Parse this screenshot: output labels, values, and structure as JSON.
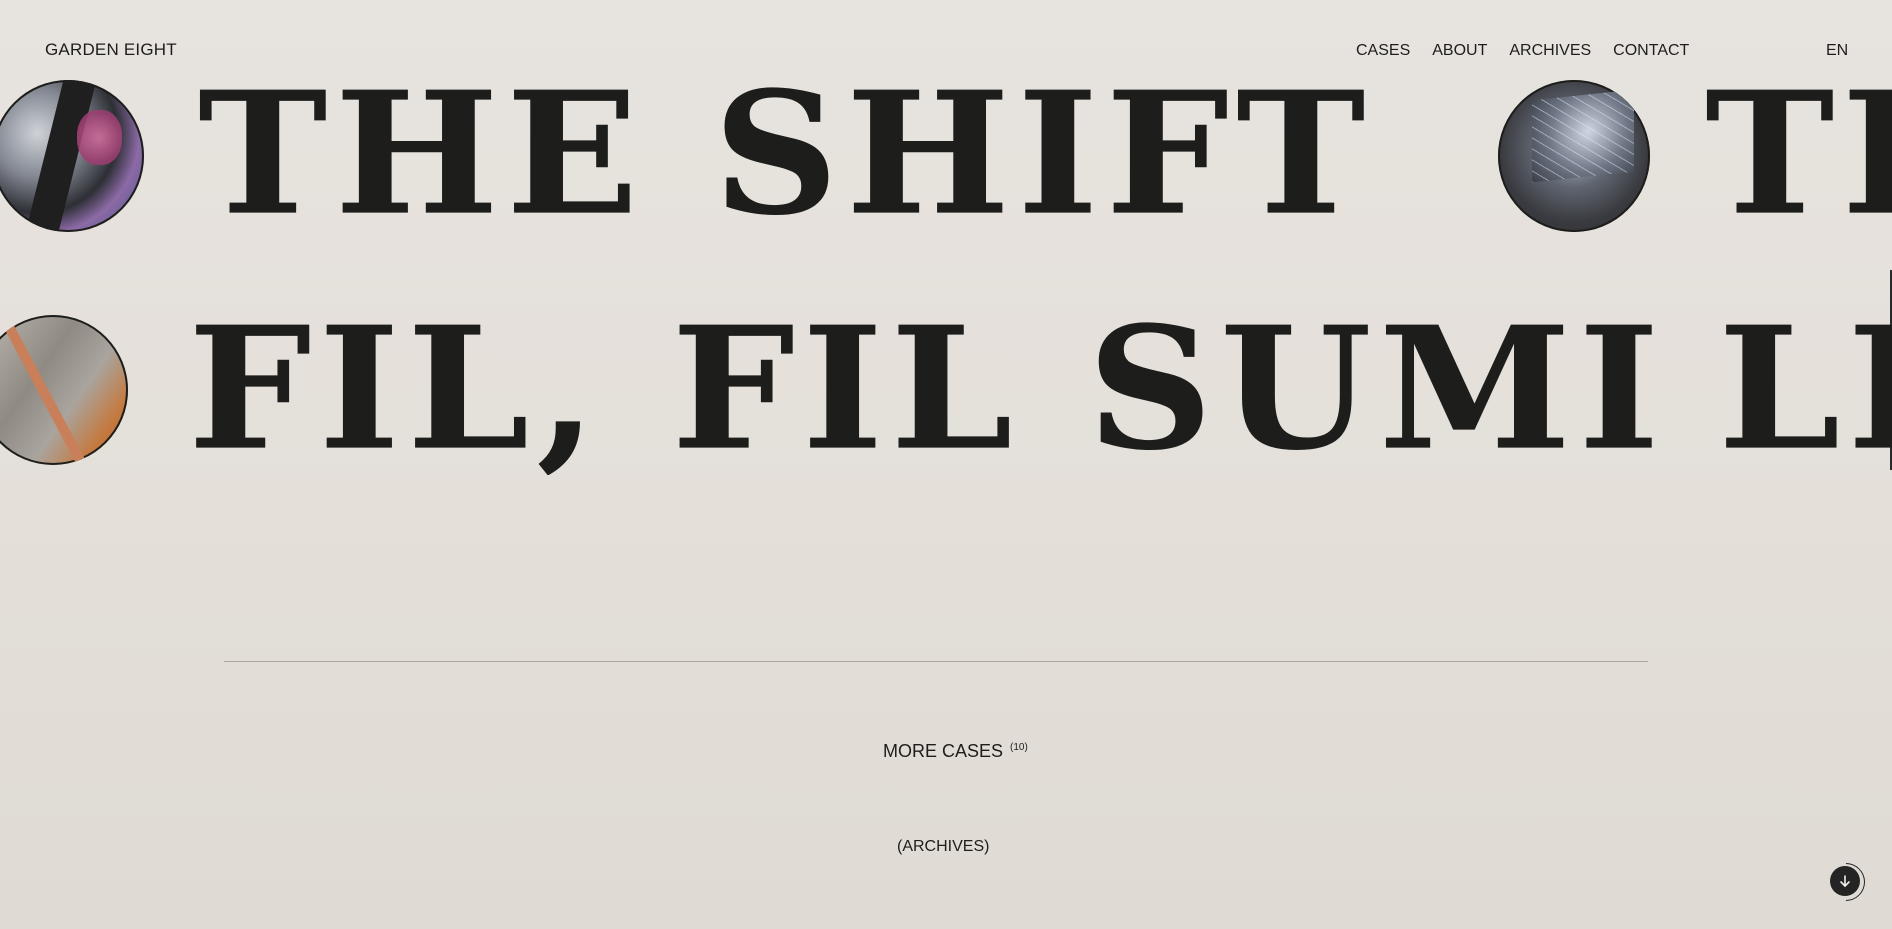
{
  "header": {
    "logo": "GARDEN EIGHT",
    "nav": [
      "CASES",
      "ABOUT",
      "ARCHIVES",
      "CONTACT"
    ],
    "language": "EN"
  },
  "hero": {
    "row1": {
      "text": "THE SHIFT",
      "repeat_text": "TH"
    },
    "row2": {
      "text": "FIL, FIL SUMI",
      "repeat_text": "LI"
    },
    "images": {
      "row1_left_icon": "car-icon",
      "row1_right_icon": "projection-icon",
      "row2_left_icon": "chair-icon"
    }
  },
  "footer_section": {
    "more_cases_label": "MORE CASES",
    "more_cases_count": "(10)",
    "archives_label": "(ARCHIVES)"
  },
  "controls": {
    "scroll_icon": "arrow-down-icon"
  }
}
